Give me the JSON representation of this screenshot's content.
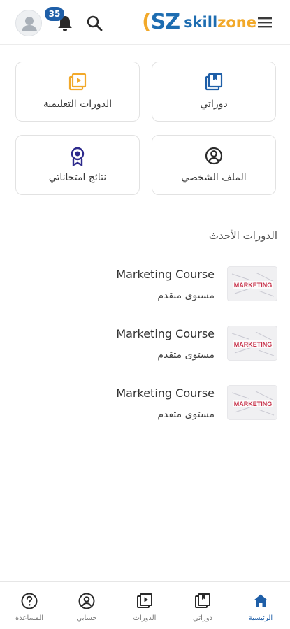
{
  "header": {
    "notification_count": "35",
    "logo": {
      "mark": "SZ",
      "text_a": "skill",
      "text_b": "zone"
    }
  },
  "tiles": [
    {
      "label": "الدورات التعليمية",
      "icon": "play-library-icon"
    },
    {
      "label": "دوراتي",
      "icon": "my-courses-icon"
    },
    {
      "label": "نتائج امتحاناتي",
      "icon": "award-icon"
    },
    {
      "label": "الملف الشخصي",
      "icon": "profile-icon"
    }
  ],
  "latest": {
    "title": "الدورات الأحدث",
    "courses": [
      {
        "title": "Marketing Course",
        "level": "مستوى متقدم",
        "thumb_text": "MARKETING"
      },
      {
        "title": "Marketing Course",
        "level": "مستوى متقدم",
        "thumb_text": "MARKETING"
      },
      {
        "title": "Marketing Course",
        "level": "مستوى متقدم",
        "thumb_text": "MARKETING"
      }
    ]
  },
  "bottom_nav": [
    {
      "label": "المساعدة",
      "icon": "help-icon"
    },
    {
      "label": "حسابي",
      "icon": "account-icon"
    },
    {
      "label": "الدورات",
      "icon": "play-icon"
    },
    {
      "label": "دوراتي",
      "icon": "my-courses-icon"
    },
    {
      "label": "الرئيسية",
      "icon": "home-icon",
      "active": true
    }
  ],
  "colors": {
    "accent_blue": "#1f5fa8",
    "brand_orange": "#f2a92a",
    "icon_dark": "#2a2a2a"
  }
}
